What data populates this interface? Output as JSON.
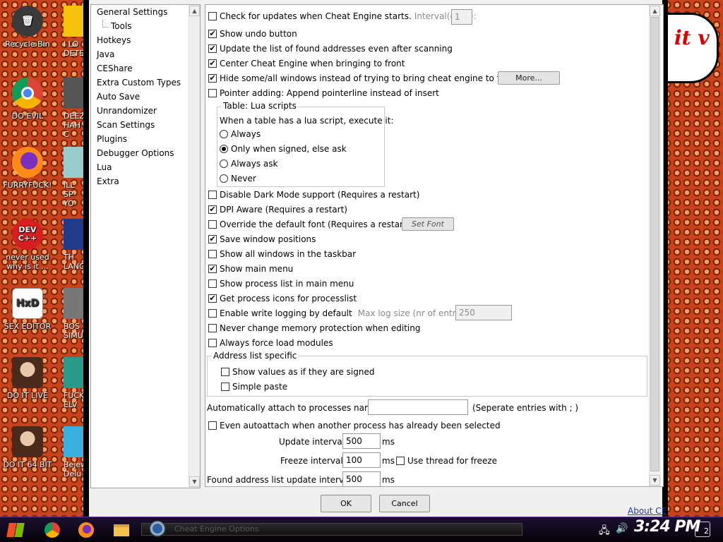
{
  "desktop": {
    "icons": [
      {
        "label": "Recycle Bin",
        "color": "#444444",
        "glyph": "🗑"
      },
      {
        "label": "DO EVIL",
        "color": "#2c8fe0",
        "glyph": ""
      },
      {
        "label": "FURRYFUCK!",
        "color": "#ff7a1a",
        "glyph": ""
      },
      {
        "label": "never used why is it ...",
        "color": "#d81e1e",
        "glyph": "DEV C++"
      },
      {
        "label": "SEX EDITOR",
        "color": "#ffffff",
        "glyph": "HxD"
      },
      {
        "label": "DO IT LIVE",
        "color": "#7a5a3a",
        "glyph": ""
      },
      {
        "label": "DO IT 64 BIT",
        "color": "#7a5a3a",
        "glyph": ""
      }
    ],
    "icons2": [
      {
        "label": "I LO DETECT"
      },
      {
        "label": "DEEZ HAH C"
      },
      {
        "label": "ILL SP YO"
      },
      {
        "label": "TH LANGUA"
      },
      {
        "label": "BOS SIMUL"
      },
      {
        "label": "FUCK ELV"
      },
      {
        "label": "Bejew Delu"
      }
    ],
    "speech_text": "it v"
  },
  "tree": {
    "items": [
      "General Settings",
      "Tools",
      "Hotkeys",
      "Java",
      "CEShare",
      "Extra Custom Types",
      "Auto Save",
      "Unrandomizer",
      "Scan Settings",
      "Plugins",
      "Debugger Options",
      "Lua",
      "Extra"
    ]
  },
  "settings": {
    "check_updates": "Check for updates when Cheat Engine starts.",
    "interval_label": "Interval(days):",
    "interval_value": "1",
    "show_undo": "Show undo button",
    "update_list": "Update the list of found addresses even after scanning",
    "center_ce": "Center Cheat Engine when bringing to front",
    "hide_windows": "Hide some/all windows instead of trying to bring cheat engine to front",
    "more_button": "More...",
    "pointer_adding": "Pointer adding: Append pointerline instead of insert",
    "lua_group_title": "Table: Lua scripts",
    "lua_prompt": "When a table has a lua script, execute it:",
    "lua_always": "Always",
    "lua_signed": "Only when signed, else ask",
    "lua_always_ask": "Always ask",
    "lua_never": "Never",
    "disable_dark": "Disable Dark Mode support (Requires a restart)",
    "dpi_aware": "DPI Aware (Requires a restart)",
    "override_font": "Override the default font (Requires a restart)",
    "set_font_button": "Set Font",
    "save_positions": "Save window positions",
    "show_all_taskbar": "Show all windows in the taskbar",
    "show_main_menu": "Show main menu",
    "show_process_list": "Show process list in main menu",
    "get_process_icons": "Get process icons for processlist",
    "enable_write_logging": "Enable write logging by default",
    "max_log_label": "Max log size (nr of entries)",
    "max_log_value": "250",
    "never_change_protection": "Never change memory protection when editing",
    "always_force_load": "Always force load modules",
    "address_group_title": "Address list specific",
    "show_signed": "Show values as if they are signed",
    "simple_paste": "Simple paste",
    "auto_attach_label": "Automatically attach to processes named",
    "auto_attach_value": "",
    "auto_attach_hint": "(Seperate entries with ; )",
    "even_autoattach": "Even autoattach when another process has already been selected",
    "update_interval_label": "Update interval",
    "update_interval_value": "500",
    "freeze_interval_label": "Freeze interval",
    "freeze_interval_value": "100",
    "ms": "ms",
    "use_thread_freeze": "Use thread for freeze",
    "found_list_label": "Found address list update interval",
    "found_list_value": "500"
  },
  "checked": {
    "check_updates": false,
    "show_undo": true,
    "update_list": true,
    "center_ce": true,
    "hide_windows": true,
    "pointer_adding": false,
    "disable_dark": false,
    "dpi_aware": true,
    "override_font": false,
    "save_positions": true,
    "show_all_taskbar": false,
    "show_main_menu": true,
    "show_process_list": false,
    "get_process_icons": true,
    "enable_write_logging": false,
    "never_change_protection": false,
    "always_force_load": false,
    "show_signed": false,
    "simple_paste": false,
    "even_autoattach": false,
    "use_thread_freeze": false
  },
  "lua_selected": "signed",
  "dialog": {
    "ok": "OK",
    "cancel": "Cancel",
    "about": "About CE"
  },
  "taskbar": {
    "clock": "3:24 PM",
    "notifications": "2",
    "window_title": "Cheat Engine Options"
  }
}
